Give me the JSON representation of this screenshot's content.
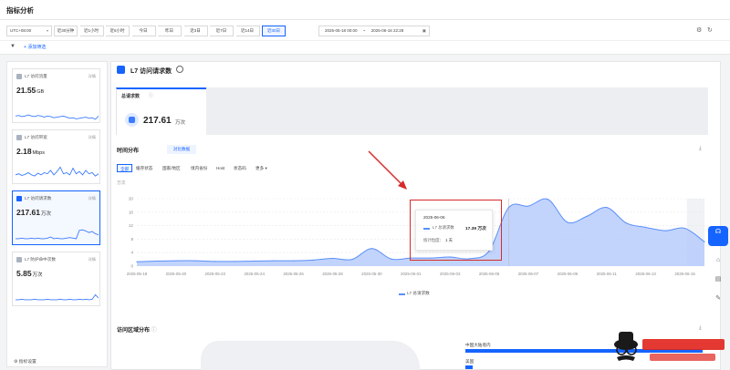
{
  "header": {
    "title": "指标分析"
  },
  "filters": {
    "timezone": "UTC+08:00",
    "ranges": [
      "近30分钟",
      "近1小时",
      "近6小时",
      "今日",
      "昨日",
      "近3日",
      "近7日",
      "近14日",
      "近30日"
    ],
    "active_range": "近30日",
    "date_start": "2025-05-18 00:00",
    "date_sep": "~",
    "date_end": "2025-06-16 22:28",
    "add_filter": "添加筛选"
  },
  "sidebar": {
    "cards": [
      {
        "title": "L7 访问流量",
        "detail": "详情",
        "value": "21.55",
        "unit": "GB",
        "spark": [
          30,
          29,
          31,
          30,
          28,
          30,
          31,
          29,
          30,
          32,
          30,
          31,
          33,
          32,
          31,
          30,
          32,
          34,
          33,
          35,
          34,
          33,
          32,
          34,
          33,
          36,
          30
        ]
      },
      {
        "title": "L7 访问带宽",
        "detail": "详情",
        "value": "2.18",
        "unit": "Mbps",
        "spark": [
          26,
          24,
          27,
          25,
          22,
          26,
          28,
          23,
          26,
          22,
          24,
          18,
          26,
          20,
          12,
          24,
          22,
          26,
          14,
          24,
          20,
          26,
          18,
          24,
          22,
          28,
          24
        ]
      },
      {
        "title": "L7 访问请求数",
        "detail": "详情",
        "value": "217.61",
        "unit": "万次",
        "spark": [
          31,
          31,
          30,
          31,
          31,
          30,
          31,
          30,
          31,
          31,
          30,
          28,
          31,
          30,
          31,
          31,
          30,
          29,
          30,
          31,
          16,
          15,
          17,
          20,
          18,
          22,
          24
        ]
      },
      {
        "title": "L7 防护命中次数",
        "detail": "详情",
        "value": "5.85",
        "unit": "万次",
        "spark": [
          31,
          31,
          30,
          31,
          31,
          31,
          30,
          31,
          31,
          31,
          30,
          31,
          31,
          31,
          30,
          31,
          31,
          30,
          31,
          31,
          30,
          31,
          30,
          31,
          30,
          22,
          28
        ]
      }
    ],
    "settings": "指标设置"
  },
  "main": {
    "title": "L7 访问请求数",
    "kpi": {
      "label": "总请求数",
      "value": "217.61",
      "unit": "万次"
    },
    "distribution": {
      "title": "时间分布",
      "compare": "对比数据",
      "tabs": [
        "全部",
        "缓存状态",
        "国家/地区",
        "境内省份",
        "Host",
        "状态码",
        "更多"
      ],
      "active_tab": "全部",
      "unit": "万次"
    },
    "region": {
      "title": "访问区域分布",
      "items": [
        {
          "name": "中国大陆境内",
          "share": 1.0
        },
        {
          "name": "美国",
          "share": 0.03
        }
      ]
    }
  },
  "chart_data": {
    "type": "area",
    "ylabel": "万次",
    "ylim": [
      0,
      20
    ],
    "yticks": [
      0,
      4,
      8,
      12,
      16,
      20
    ],
    "x": [
      "2025-05-18",
      "2025-05-19",
      "2025-05-20",
      "2025-05-21",
      "2025-05-22",
      "2025-05-23",
      "2025-05-24",
      "2025-05-25",
      "2025-05-26",
      "2025-05-27",
      "2025-05-28",
      "2025-05-29",
      "2025-05-30",
      "2025-05-31",
      "2025-06-01",
      "2025-06-02",
      "2025-06-03",
      "2025-06-04",
      "2025-06-05",
      "2025-06-06",
      "2025-06-07",
      "2025-06-08",
      "2025-06-09",
      "2025-06-10",
      "2025-06-11",
      "2025-06-12",
      "2025-06-13",
      "2025-06-14",
      "2025-06-15",
      "2025-06-16"
    ],
    "xticks": [
      "2025-05-18",
      "2025-05-20",
      "2025-05-22",
      "2025-05-24",
      "2025-05-26",
      "2025-05-28",
      "2025-05-30",
      "2025-06-01",
      "2025-06-03",
      "2025-06-05",
      "2025-06-07",
      "2025-06-09",
      "2025-06-11",
      "2025-06-13",
      "2025-06-15"
    ],
    "series": [
      {
        "name": "L7 总请求数",
        "values": [
          1.3,
          1.5,
          1.6,
          1.6,
          1.4,
          1.4,
          1.5,
          1.6,
          1.6,
          1.8,
          2.3,
          2.0,
          5.2,
          2.1,
          2.4,
          2.4,
          2.7,
          2.2,
          4.5,
          17.39,
          17.8,
          19.8,
          13.0,
          14.8,
          17.4,
          12.8,
          11.5,
          10.5,
          11.2,
          7.2
        ]
      }
    ],
    "tooltip": {
      "date": "2025-06-06",
      "series": "L7 总请求数",
      "value": "17.39 万次",
      "granularity_label": "统计粒度：",
      "granularity_value": "1 天"
    },
    "grid": true,
    "legend": "bottom-center"
  }
}
